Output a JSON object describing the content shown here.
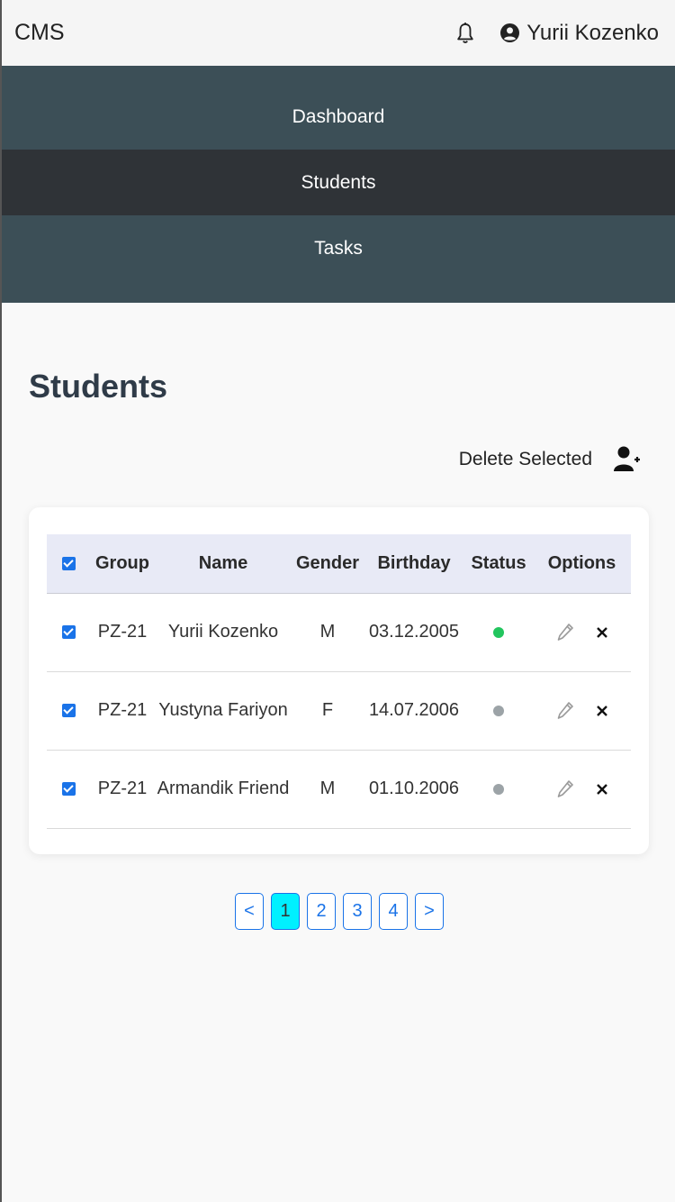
{
  "app": {
    "brand": "CMS"
  },
  "user": {
    "name": "Yurii Kozenko"
  },
  "nav": {
    "items": [
      {
        "label": "Dashboard",
        "active": false
      },
      {
        "label": "Students",
        "active": true
      },
      {
        "label": "Tasks",
        "active": false
      }
    ]
  },
  "page": {
    "title": "Students"
  },
  "actions": {
    "delete_selected": "Delete Selected"
  },
  "table": {
    "headers": {
      "group": "Group",
      "name": "Name",
      "gender": "Gender",
      "birthday": "Birthday",
      "status": "Status",
      "options": "Options"
    },
    "rows": [
      {
        "group": "PZ-21",
        "name": "Yurii Kozenko",
        "gender": "M",
        "birthday": "03.12.2005",
        "status": "active"
      },
      {
        "group": "PZ-21",
        "name": "Yustyna Fariyon",
        "gender": "F",
        "birthday": "14.07.2006",
        "status": "inactive"
      },
      {
        "group": "PZ-21",
        "name": "Armandik Friend",
        "gender": "M",
        "birthday": "01.10.2006",
        "status": "inactive"
      }
    ]
  },
  "pagination": {
    "prev": "<",
    "next": ">",
    "pages": [
      "1",
      "2",
      "3",
      "4"
    ],
    "current": "1"
  },
  "colors": {
    "status_active": "#22c55e",
    "status_inactive": "#9ca3a7",
    "nav_bg": "#3c4f57",
    "nav_active_bg": "#2f3337",
    "accent": "#1a73e8",
    "page_active_bg": "#00f0ff"
  }
}
